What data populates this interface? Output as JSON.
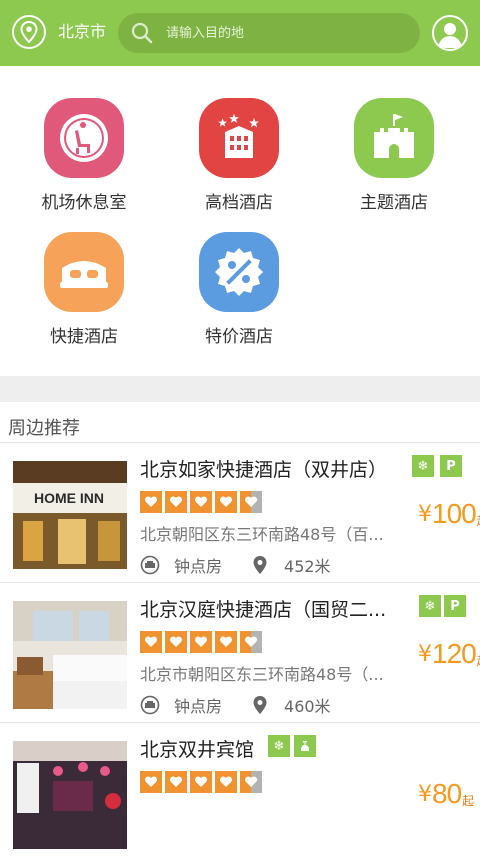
{
  "header": {
    "city": "北京市",
    "search_placeholder": "请输入目的地"
  },
  "categories": [
    {
      "label": "机场休息室",
      "icon": "airport-lounge-icon",
      "color": "#e0587a"
    },
    {
      "label": "高档酒店",
      "icon": "luxury-hotel-icon",
      "color": "#e24444"
    },
    {
      "label": "主题酒店",
      "icon": "castle-icon",
      "color": "#8dc94f"
    },
    {
      "label": "快捷酒店",
      "icon": "bed-icon",
      "color": "#f6a259"
    },
    {
      "label": "特价酒店",
      "icon": "discount-icon",
      "color": "#5b9be0"
    }
  ],
  "nearby": {
    "title": "周边推荐",
    "hotels": [
      {
        "name": "北京如家快捷酒店（双井店）",
        "rating": 4.5,
        "address": "北京朝阳区东三环南路48号（百...",
        "room_type": "钟点房",
        "distance": "452米",
        "price_symbol": "¥",
        "price": "100",
        "price_suffix": "起",
        "features": [
          "wifi",
          "P"
        ],
        "photo_sign": "HOME INN"
      },
      {
        "name": "北京汉庭快捷酒店（国贸二...",
        "rating": 4.5,
        "address": "北京市朝阳区东三环南路48号（...",
        "room_type": "钟点房",
        "distance": "460米",
        "price_symbol": "¥",
        "price": "120",
        "price_suffix": "起",
        "features": [
          "wifi",
          "P"
        ]
      },
      {
        "name": "北京双井宾馆",
        "rating": 4.5,
        "address": "",
        "room_type": "",
        "distance": "",
        "price_symbol": "¥",
        "price": "80",
        "price_suffix": "起",
        "features": [
          "wifi",
          "breakfast"
        ]
      }
    ]
  },
  "colors": {
    "brand_green": "#8dc94f",
    "price_orange": "#f39a1f",
    "rating_orange": "#f0922f"
  }
}
